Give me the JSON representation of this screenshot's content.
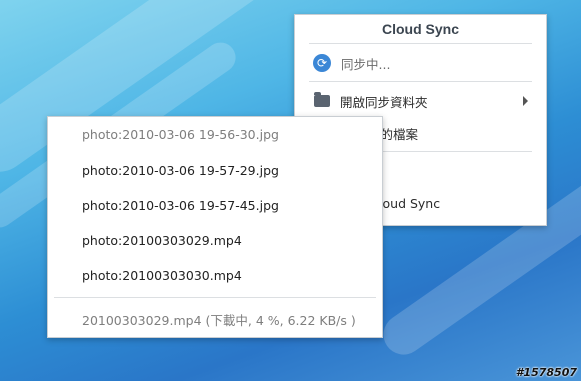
{
  "menu": {
    "title": "Cloud Sync",
    "items": [
      {
        "label": "同步中...",
        "icon": "sync-icon"
      },
      {
        "label": "開啟同步資料夾",
        "icon": "folder-icon",
        "submenu": true
      },
      {
        "label": "…的檔案",
        "icon": ""
      },
      {
        "label": "…",
        "icon": ""
      },
      {
        "label": "…oud Sync",
        "icon": ""
      }
    ]
  },
  "files": [
    {
      "label": "photo:2010-03-06 19-56-30.jpg",
      "dim": true
    },
    {
      "label": "photo:2010-03-06 19-57-29.jpg",
      "dim": false
    },
    {
      "label": "photo:2010-03-06 19-57-45.jpg",
      "dim": false
    },
    {
      "label": "photo:20100303029.mp4",
      "dim": false
    },
    {
      "label": "photo:20100303030.mp4",
      "dim": false
    }
  ],
  "status": "20100303029.mp4 (下載中, 4 %, 6.22 KB/s )",
  "watermark": "#1578507",
  "colors": {
    "accent": "#3b87d6",
    "desktop": "#2d8ed4"
  }
}
